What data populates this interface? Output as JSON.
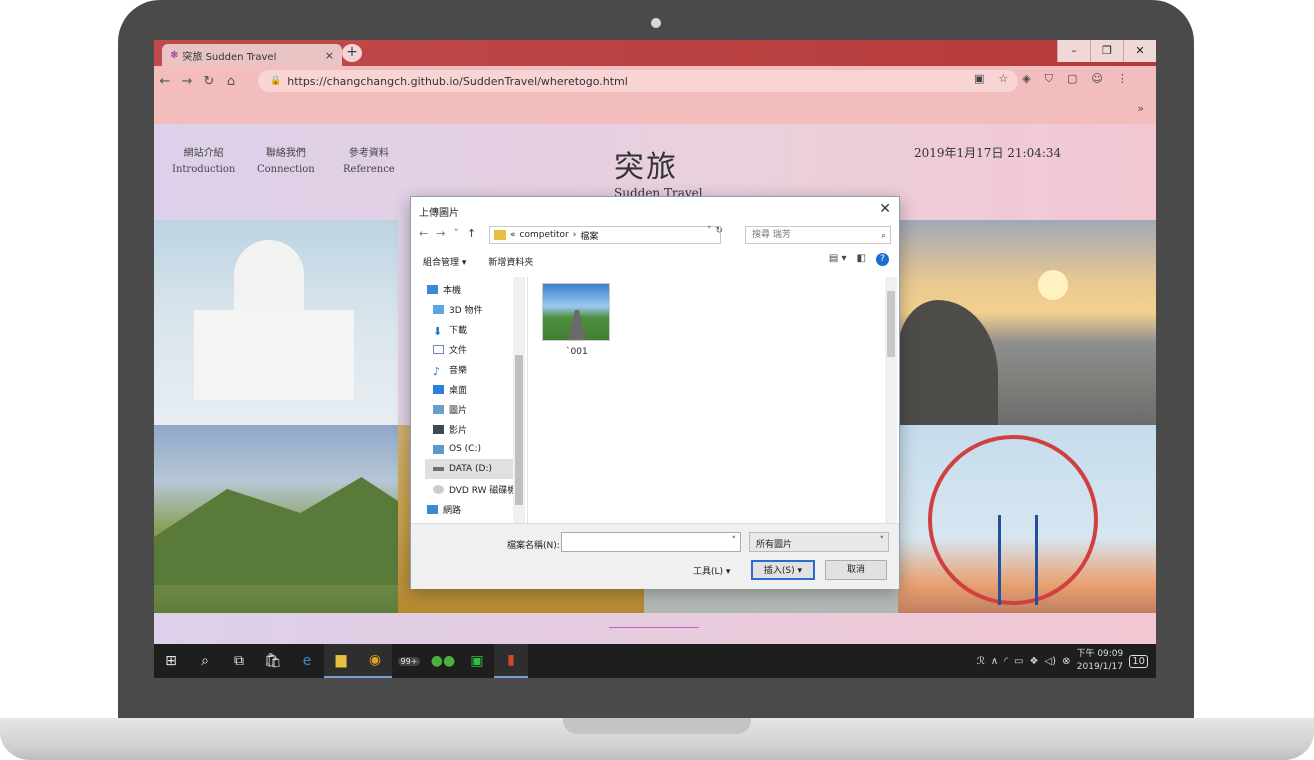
{
  "browser": {
    "tab_title": "突旅 Sudden Travel",
    "tab_close": "×",
    "new_tab": "+",
    "url": "https://changchangch.github.io/SuddenTravel/wheretogo.html",
    "overflow": "»",
    "window": {
      "minimize": "–",
      "maximize": "❐",
      "close": "✕"
    }
  },
  "site": {
    "nav": [
      {
        "zh": "網站介紹",
        "en": "Introduction"
      },
      {
        "zh": "聯絡我們",
        "en": "Connection"
      },
      {
        "zh": "參考資料",
        "en": "Reference"
      }
    ],
    "title": "突旅",
    "subtitle": "Sudden Travel",
    "clock": "2019年1月17日 21:04:34"
  },
  "dialog": {
    "title": "上傳圖片",
    "path": [
      "«",
      "competitor",
      "›",
      "檔案"
    ],
    "search_placeholder": "搜尋 瑞芳",
    "organize": "組合管理 ▾",
    "new_folder": "新增資料夾",
    "tree": [
      {
        "label": "本機",
        "icon": "computer-icon"
      },
      {
        "label": "3D 物件",
        "icon": "3d-objects-icon"
      },
      {
        "label": "下載",
        "icon": "download-icon"
      },
      {
        "label": "文件",
        "icon": "document-icon"
      },
      {
        "label": "音樂",
        "icon": "music-icon"
      },
      {
        "label": "桌面",
        "icon": "desktop-icon"
      },
      {
        "label": "圖片",
        "icon": "pictures-icon"
      },
      {
        "label": "影片",
        "icon": "videos-icon"
      },
      {
        "label": "OS (C:)",
        "icon": "drive-icon"
      },
      {
        "label": "DATA (D:)",
        "icon": "drive-icon"
      },
      {
        "label": "DVD RW 磁碟機",
        "icon": "dvd-icon"
      },
      {
        "label": "網路",
        "icon": "network-icon"
      }
    ],
    "selected_tree_item": "DATA (D:)",
    "files": [
      {
        "name": "`001"
      }
    ],
    "filename_label": "檔案名稱(N):",
    "filename_value": "",
    "filetype": "所有圖片",
    "tools": "工具(L)  ▾",
    "insert": "插入(S)",
    "cancel": "取消"
  },
  "taskbar": {
    "notification_count": "99+",
    "time": "下午 09:09",
    "date": "2019/1/17",
    "action_center_count": "10"
  },
  "colors": {
    "tab_strip": "#c04a4a",
    "toolbar": "#f3bdbd",
    "insert_button_border": "#2a6cd0"
  }
}
